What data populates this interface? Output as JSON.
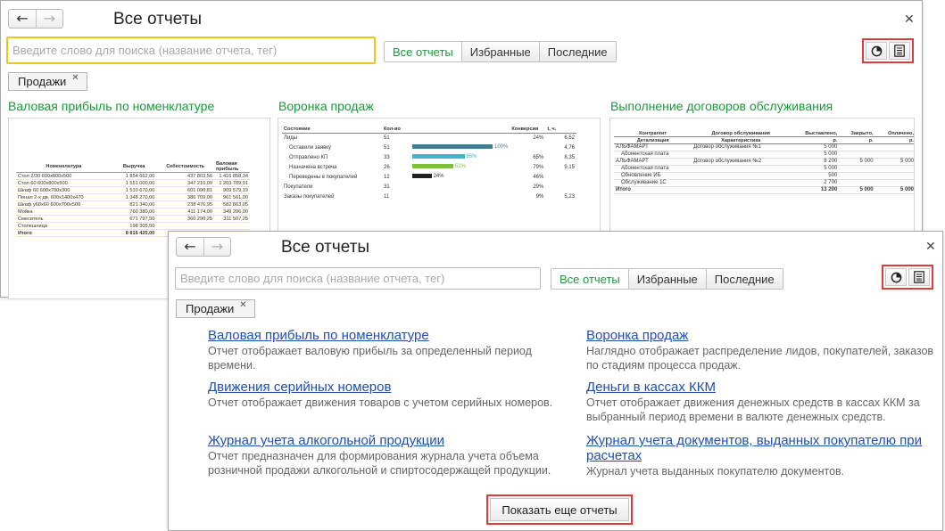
{
  "window_back": {
    "title": "Все отчеты",
    "search_placeholder": "Введите слово для поиска (название отчета, тег)",
    "tabs": [
      "Все отчеты",
      "Избранные",
      "Последние"
    ],
    "chip": "Продажи",
    "cards": [
      {
        "title": "Валовая прибыль по номенклатуре",
        "headers": [
          "Номенклатура",
          "Выручка",
          "Себестоимость",
          "Валовая прибыль"
        ],
        "rows": [
          [
            "Стол 2/30 600х800х500",
            "1 854 662,00",
            "437 803,56",
            "1 416 858,34"
          ],
          [
            "Стол 60 600х800х500",
            "1 551 000,00",
            "347 210,09",
            "1 203 789,91"
          ],
          [
            "Шкаф 60 600х700х300",
            "1 510 670,00",
            "601 090,81",
            "909 579,19"
          ],
          [
            "Пенал 2-х дв. 600х1400х470",
            "1 348 270,00",
            "386 709,00",
            "961 561,00"
          ],
          [
            "Шкаф у60х60 600х700х500",
            "821 340,00",
            "238 476,95",
            "582 863,05"
          ],
          [
            "Мойка",
            "760 380,00",
            "411 174,00",
            "349 206,00"
          ],
          [
            "Смеситель",
            "671 797,50",
            "360 290,25",
            "311 507,25"
          ],
          [
            "Столешница",
            "198 305,50",
            "",
            ""
          ],
          [
            "Итого",
            "8 816 425,00",
            "",
            ""
          ]
        ]
      },
      {
        "title": "Воронка продаж",
        "headers": [
          "Состояние",
          "Кол-во",
          "",
          "Конверсия",
          "t, ч."
        ],
        "rows": [
          {
            "label": "Лиды",
            "count": "51",
            "pct": "",
            "conv": "24%",
            "t": "6,52",
            "indent": false
          },
          {
            "label": "Оставили заявку",
            "count": "51",
            "pct": "100%",
            "conv": "",
            "t": "4,76",
            "indent": true,
            "bar": 100
          },
          {
            "label": "Отправлено КП",
            "count": "33",
            "pct": "65%",
            "conv": "65%",
            "t": "8,35",
            "indent": true,
            "bar": 65
          },
          {
            "label": "Назначена встреча",
            "count": "26",
            "pct": "51%",
            "conv": "79%",
            "t": "9,15",
            "indent": true,
            "bar": 51
          },
          {
            "label": "Переведены в покупателей",
            "count": "12",
            "pct": "24%",
            "conv": "46%",
            "t": "",
            "indent": true,
            "bar": 24
          },
          {
            "label": "Покупатели",
            "count": "31",
            "pct": "",
            "conv": "29%",
            "t": "",
            "indent": false
          },
          {
            "label": "Заказы покупателей",
            "count": "11",
            "pct": "",
            "conv": "9%",
            "t": "5,23",
            "indent": false
          }
        ],
        "colors": {
          "bar_main": "#3f7f96",
          "bar_alt": "#44b4c8",
          "bar_green": "#7ec13f",
          "bar_dark": "#222222"
        }
      },
      {
        "title": "Выполнение договоров обслуживания",
        "headers": [
          "Контрагент / Детализация",
          "Договор обслуживания / Характеристика",
          "Выставлено, р.",
          "Закрыто, р.",
          "Оплачено, р."
        ],
        "header_top": [
          "Контрагент",
          "Договор обслуживания",
          "Выставлено,",
          "Закрыто,",
          "Оплачено,"
        ],
        "header_bottom": [
          "Детализация",
          "Характеристика",
          "р.",
          "р.",
          "р."
        ],
        "rows": [
          [
            "АЛЬФАМАРТ",
            "Договор обслуживания №1",
            "5 000",
            "",
            ""
          ],
          [
            "Абонентская плата",
            "",
            "5 000",
            "",
            ""
          ],
          [
            "АЛЬФАМАРТ",
            "Договор обслуживания №2",
            "8 200",
            "5 000",
            "5 000"
          ],
          [
            "Абонентская плата",
            "",
            "5 000",
            "",
            ""
          ],
          [
            "Обновление ИБ",
            "",
            "500",
            "",
            ""
          ],
          [
            "Обслуживание 1С",
            "",
            "2 700",
            "",
            ""
          ],
          [
            "Итого",
            "",
            "13 200",
            "5 000",
            "5 000"
          ]
        ]
      }
    ]
  },
  "window_front": {
    "title": "Все отчеты",
    "search_placeholder": "Введите слово для поиска (название отчета, тег)",
    "tabs": [
      "Все отчеты",
      "Избранные",
      "Последние"
    ],
    "chip": "Продажи",
    "reports_left": [
      {
        "title": "Валовая прибыль по номенклатуре",
        "desc": "Отчет отображает валовую прибыль за определенный период времени."
      },
      {
        "title": "Движения серийных номеров",
        "desc": "Отчет отображает движения товаров с учетом серийных номеров."
      },
      {
        "title": "Журнал учета алкогольной продукции",
        "desc": "Отчет предназначен для формирования журнала учета объема розничной продажи алкогольной и спиртосодержащей продукции."
      }
    ],
    "reports_right": [
      {
        "title": "Воронка продаж",
        "desc": "Наглядно отображает распределение лидов, покупателей, заказов по стадиям процесса продаж."
      },
      {
        "title": "Деньги в кассах ККМ",
        "desc": "Отчет отображает движения денежных средств в кассах ККМ за выбранный период времени в валюте денежных средств."
      },
      {
        "title": "Журнал учета документов, выданных покупателю при расчетах",
        "desc": "Журнал учета выданных покупателю документов."
      }
    ],
    "more_button": "Показать еще отчеты"
  },
  "icons": {
    "back": "arrow-left-icon",
    "forward": "arrow-right-icon",
    "close": "close-icon",
    "chart_view": "pie-chart-icon",
    "list_view": "list-icon",
    "chip_remove": "close-icon"
  },
  "colors": {
    "accent_green": "#1a9a3a",
    "link_blue": "#1f4fb0",
    "highlight_red": "#e03b3b",
    "search_focus": "#f0c419"
  }
}
